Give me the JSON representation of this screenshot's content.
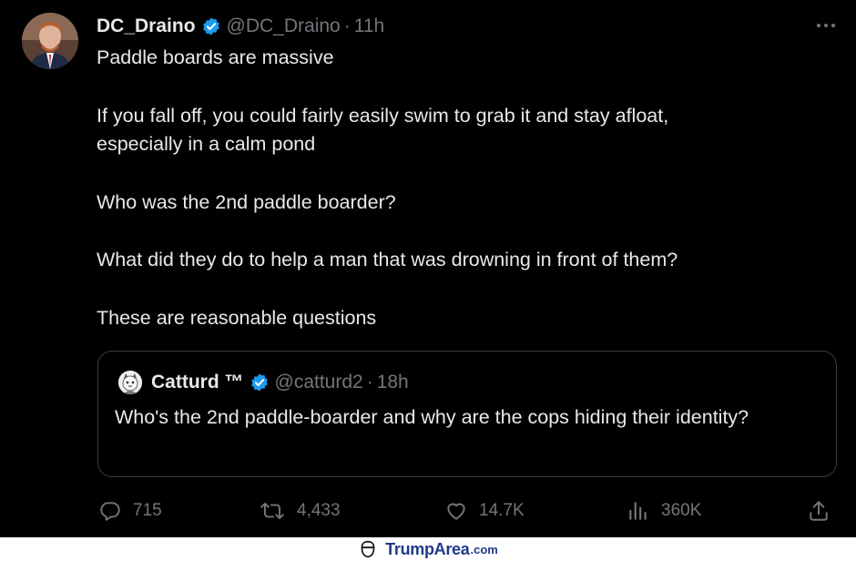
{
  "tweet": {
    "display_name": "DC_Draino",
    "handle": "@DC_Draino",
    "separator": "·",
    "time": "11h",
    "lines": [
      "Paddle boards are massive",
      "If you fall off, you could fairly easily swim to grab it and stay afloat,",
      "especially in a calm pond",
      "Who was the 2nd paddle boarder?",
      "What did they do to help a man that was drowning in front of them?",
      "These are reasonable questions"
    ]
  },
  "quote": {
    "display_name": "Catturd ™",
    "handle": "@catturd2",
    "separator": "·",
    "time": "18h",
    "text": "Who's the 2nd paddle-boarder and why are the cops hiding their identity?"
  },
  "actions": {
    "replies": "715",
    "retweets": "4,433",
    "likes": "14.7K",
    "views": "360K"
  },
  "watermark": {
    "brand": "TrumpArea",
    "tld": ".com"
  },
  "colors": {
    "background": "#000000",
    "text": "#e7e9ea",
    "muted": "#71767b",
    "verified": "#1d9bf0",
    "border": "#3a3f44",
    "watermark": "#1e3a8a"
  },
  "icons": [
    "verified-badge-icon",
    "more-icon",
    "reply-icon",
    "retweet-icon",
    "like-icon",
    "views-icon",
    "share-icon",
    "watermark-logo-icon"
  ]
}
